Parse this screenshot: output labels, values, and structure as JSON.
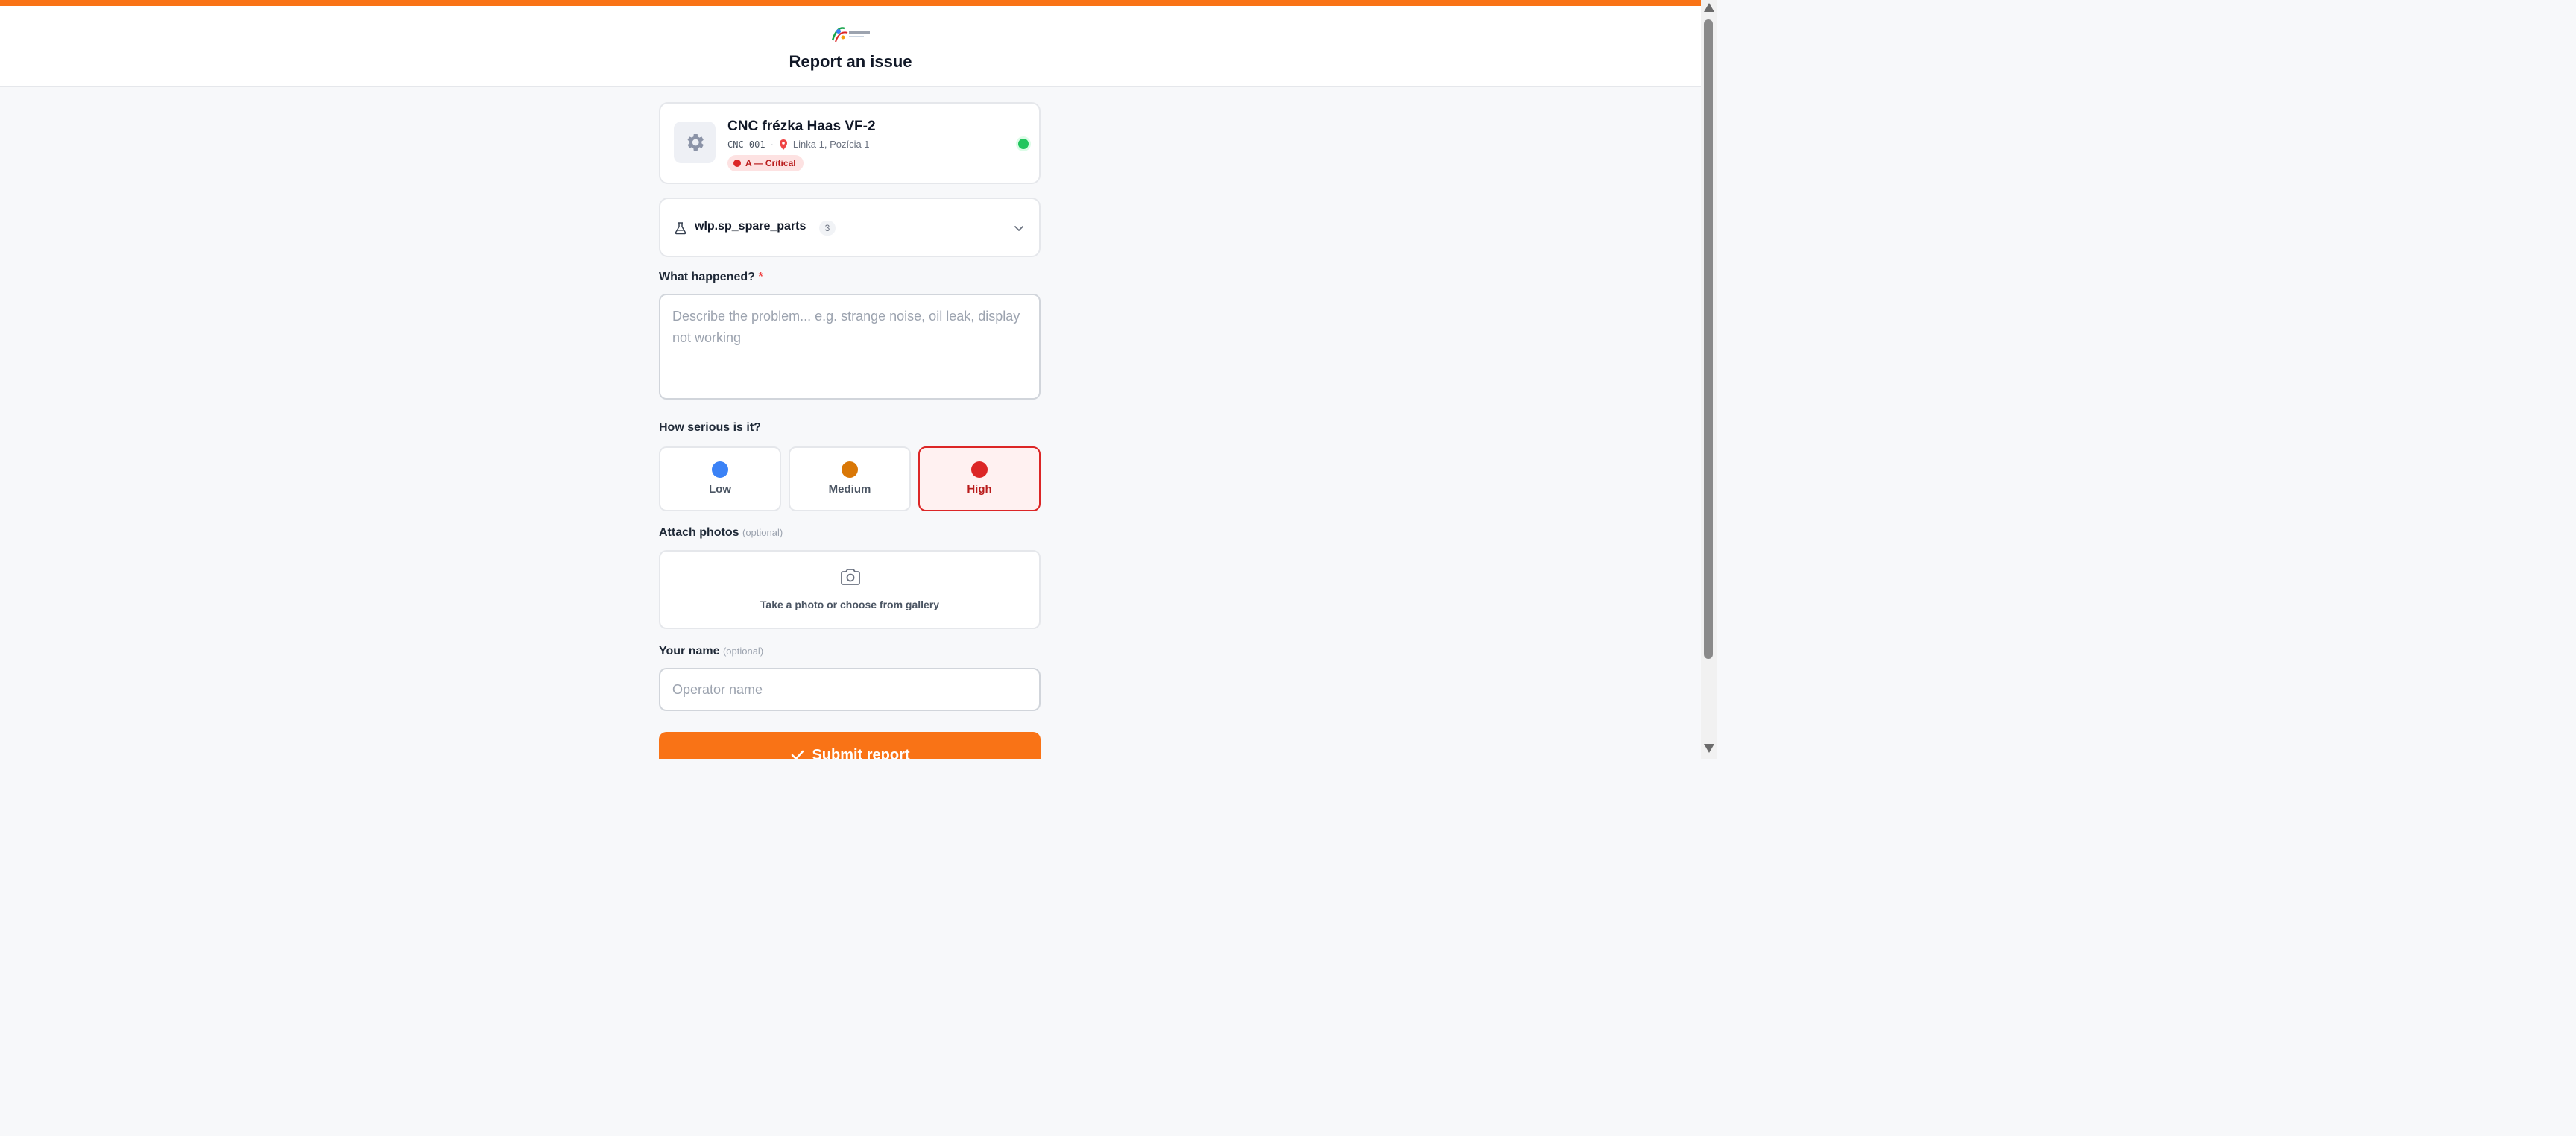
{
  "colors": {
    "accent": "#f97316",
    "critical": "#dc2626",
    "status_online": "#22c55e",
    "severity_low": "#3b82f6",
    "severity_medium": "#d97706",
    "severity_high": "#dc2626"
  },
  "header": {
    "logo_icon": "company-logo-icon",
    "title": "Report an issue"
  },
  "machine": {
    "icon": "gear-icon",
    "name": "CNC frézka Haas VF-2",
    "code": "CNC-001",
    "separator": "·",
    "location": "Linka 1, Pozícia 1",
    "criticality": "A — Critical",
    "status_icon": "online-status-dot"
  },
  "spare_parts": {
    "label": "wlp.sp_spare_parts",
    "count": "3",
    "icon": "flask-icon",
    "toggle_icon": "chevron-down-icon"
  },
  "problem": {
    "label": "What happened?",
    "required_mark": "*",
    "placeholder": "Describe the problem... e.g. strange noise, oil leak, display not working",
    "value": ""
  },
  "severity": {
    "label": "How serious is it?",
    "selected": "High",
    "options": [
      {
        "label": "Low",
        "color": "#3b82f6"
      },
      {
        "label": "Medium",
        "color": "#d97706"
      },
      {
        "label": "High",
        "color": "#dc2626"
      }
    ]
  },
  "photos": {
    "label": "Attach photos",
    "optional": "(optional)",
    "icon": "camera-icon",
    "text": "Take a photo or choose from gallery"
  },
  "name": {
    "label": "Your name",
    "optional": "(optional)",
    "placeholder": "Operator name",
    "value": ""
  },
  "submit": {
    "label": "Submit report",
    "icon": "check-icon"
  }
}
